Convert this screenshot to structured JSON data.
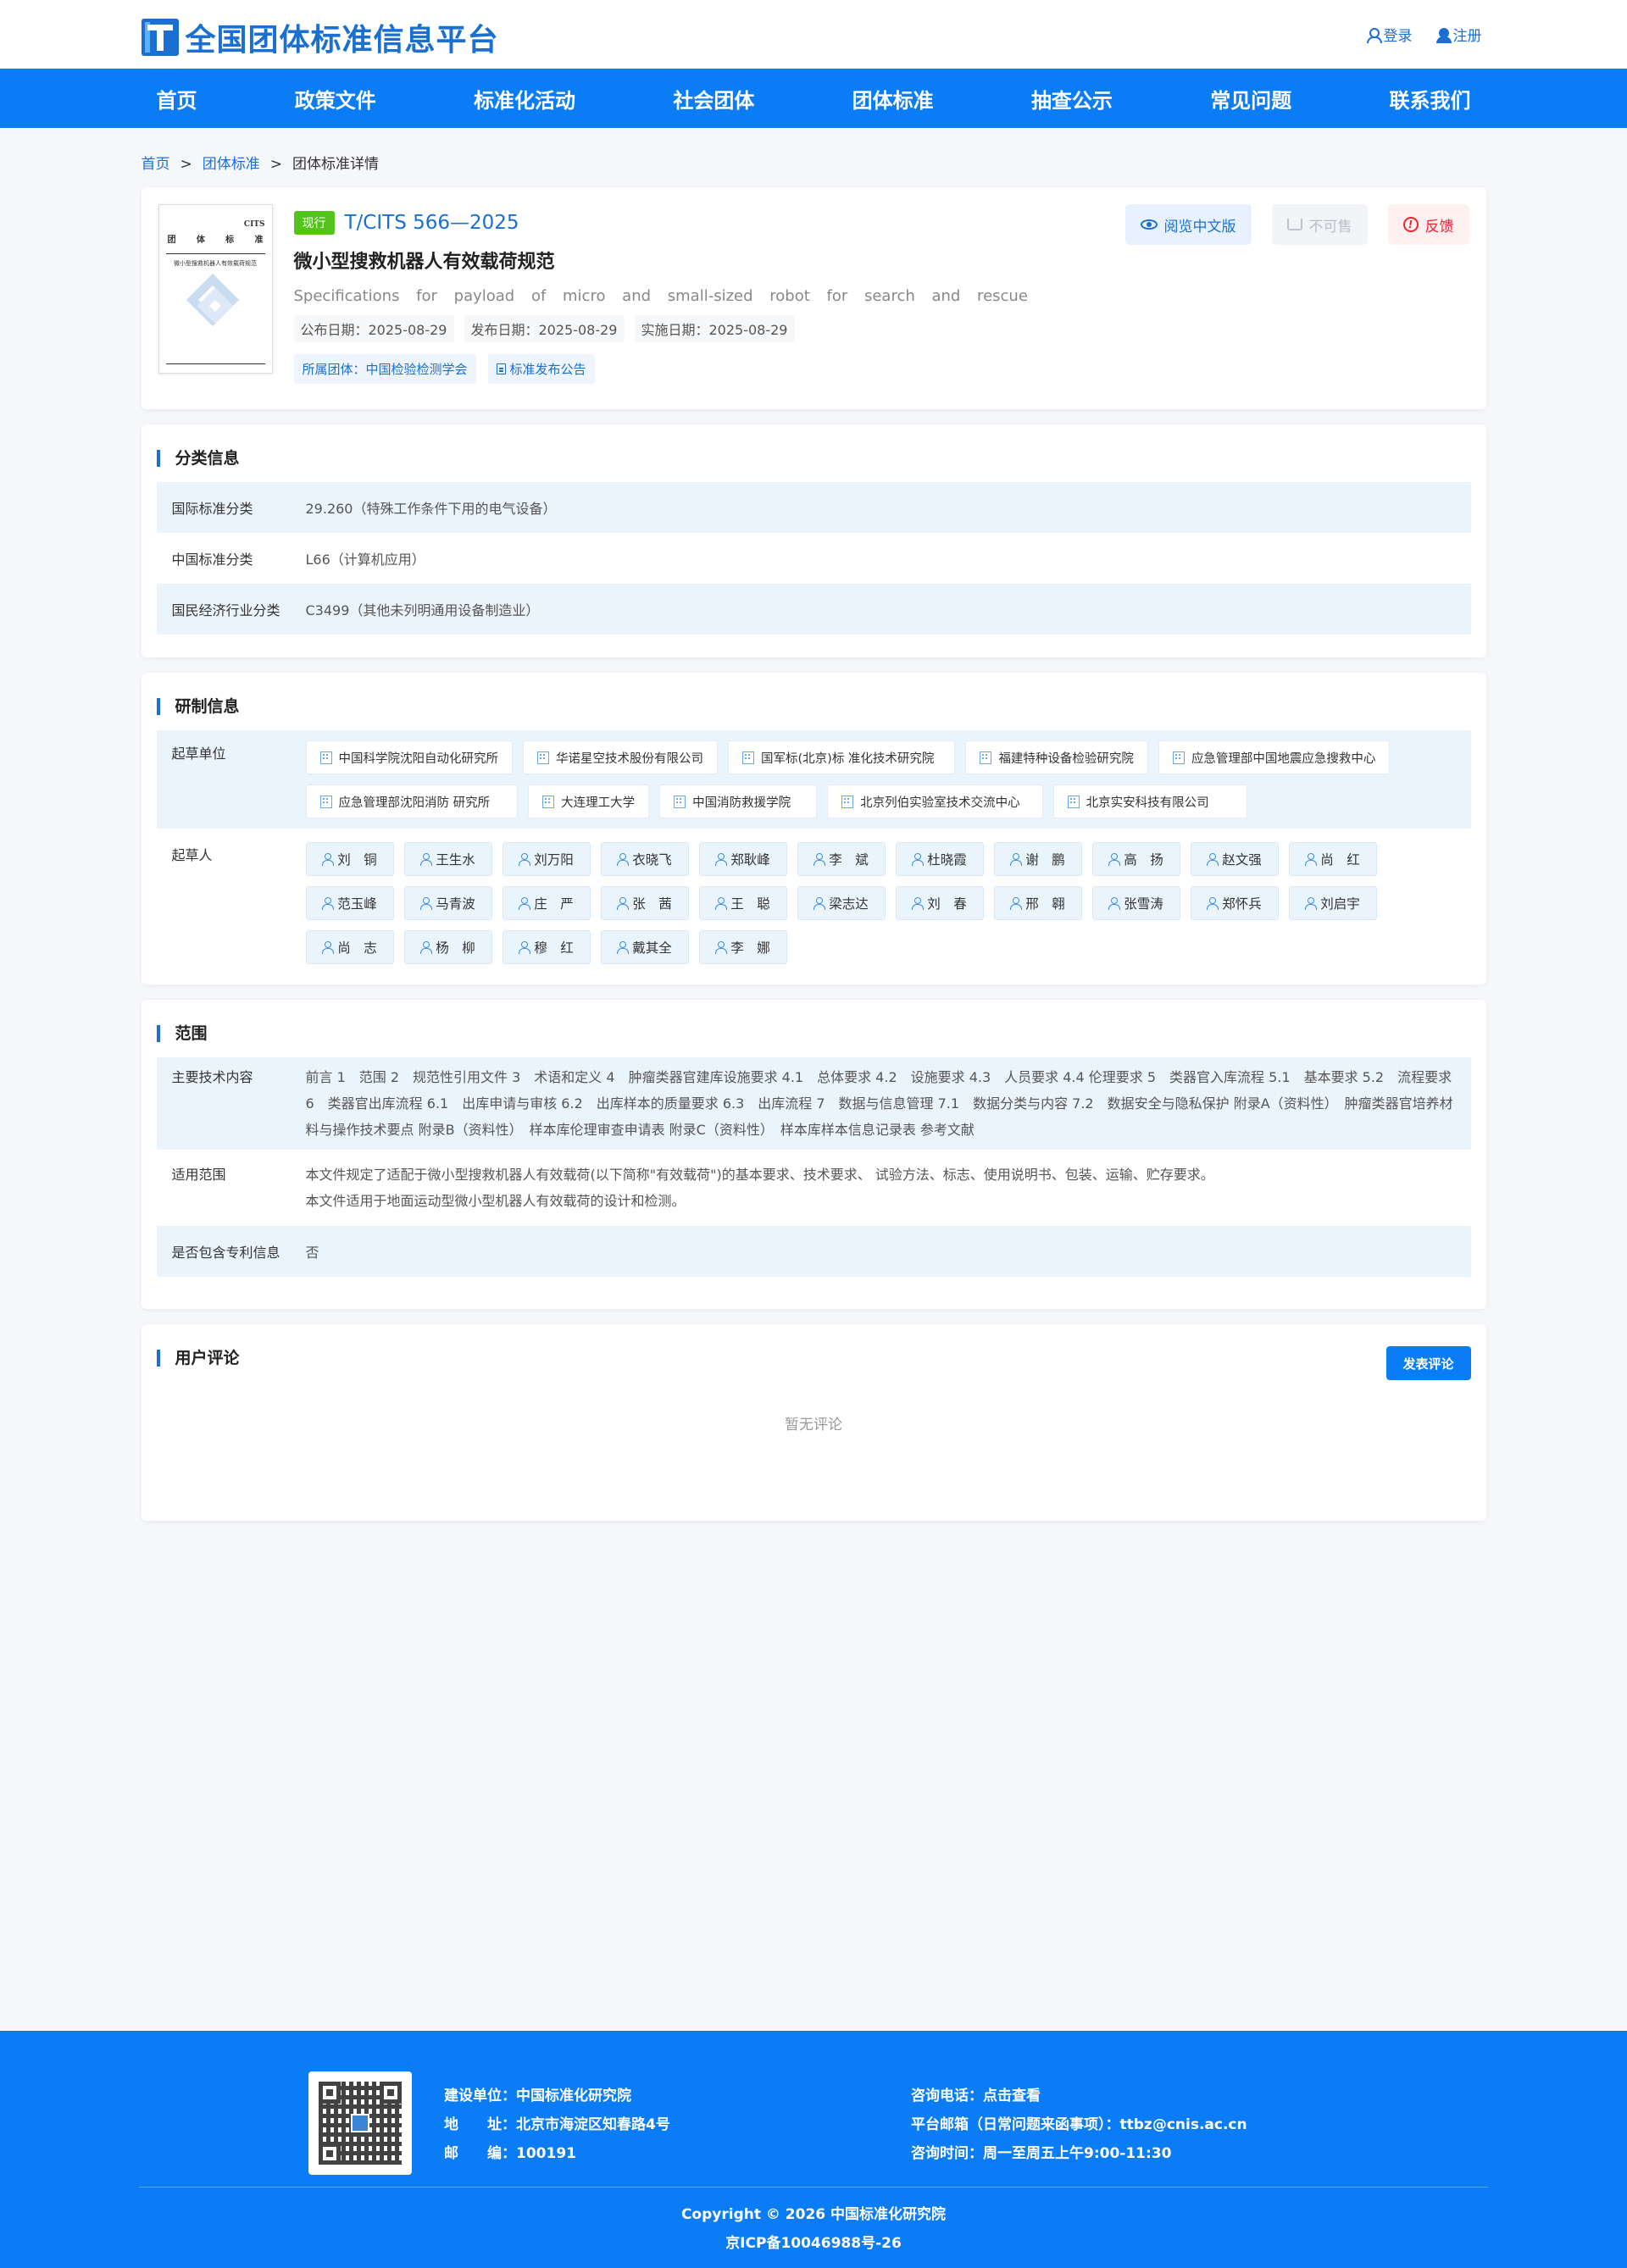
{
  "site": {
    "logo_text": "全国团体标准信息平台",
    "login": "登录",
    "register": "注册"
  },
  "nav": [
    "首页",
    "政策文件",
    "标准化活动",
    "社会团体",
    "团体标准",
    "抽查公示",
    "常见问题",
    "联系我们"
  ],
  "breadcrumb": {
    "home": "首页",
    "sep": ">",
    "level1": "团体标准",
    "current": "团体标准详情"
  },
  "standard": {
    "status": "现行",
    "code": "T/CITS 566—2025",
    "title": "微小型搜救机器人有效载荷规范",
    "title_en": "Specifications for payload of micro and small-sized robot for search and rescue",
    "dates": [
      "公布日期：2025-08-29",
      "发布日期：2025-08-29",
      "实施日期：2025-08-29"
    ],
    "org_tag": "所属团体：中国检验检测学会",
    "announce_tag": "标准发布公告",
    "actions": {
      "read": "阅览中文版",
      "nosale": "不可售",
      "feedback": "反馈"
    },
    "cover": {
      "top": "CITS",
      "name1": "团",
      "name2": "体",
      "name3": "标",
      "name4": "准",
      "title": "微小型搜救机器人有效载荷规范"
    }
  },
  "classification": {
    "title": "分类信息",
    "rows": [
      {
        "k": "国际标准分类",
        "v": "29.260（特殊工作条件下用的电气设备）"
      },
      {
        "k": "中国标准分类",
        "v": "L66（计算机应用）"
      },
      {
        "k": "国民经济行业分类",
        "v": "C3499（其他未列明通用设备制造业）"
      }
    ]
  },
  "development": {
    "title": "研制信息",
    "orgs_label": "起草单位",
    "orgs": [
      "中国科学院沈阳自动化研究所",
      "华诺星空技术股份有限公司",
      "国军标(北京)标 准化技术研究院",
      "福建特种设备检验研究院",
      "应急管理部中国地震应急搜救中心",
      "应急管理部沈阳消防 研究所",
      "大连理工大学",
      "中国消防救援学院",
      "北京列伯实验室技术交流中心",
      "北京实安科技有限公司"
    ],
    "persons_label": "起草人",
    "persons": [
      "刘　铜",
      "王生水",
      "刘万阳",
      "衣晓飞",
      "郑耿峰",
      "李　斌",
      "杜晓霞",
      "谢　鹏",
      "高　扬",
      "赵文强",
      "尚　红",
      "范玉峰",
      "马青波",
      "庄　严",
      "张　茜",
      "王　聪",
      "梁志达",
      "刘　春",
      "邢　翱",
      "张雪涛",
      "郑怀兵",
      "刘启宇",
      "尚　志",
      "杨　柳",
      "穆　红",
      "戴其全",
      "李　娜"
    ]
  },
  "scope": {
    "title": "范围",
    "tech_label": "主要技术内容",
    "tech_content": "前言 1　范围 2　规范性引用文件 3　术语和定义 4　肿瘤类器官建库设施要求 4.1　总体要求 4.2　设施要求 4.3　人员要求 4.4 伦理要求 5　类器官入库流程 5.1　基本要求 5.2　流程要求 6　类器官出库流程 6.1　出库申请与审核 6.2　出库样本的质量要求 6.3　出库流程 7　数据与信息管理 7.1　数据分类与内容 7.2　数据安全与隐私保护 附录A（资料性）　肿瘤类器官培养材料与操作技术要点 附录B（资料性）　样本库伦理审查申请表 附录C（资料性）　样本库样本信息记录表 参考文献",
    "range_label": "适用范围",
    "range_line1": "本文件规定了适配于微小型搜救机器人有效载荷(以下简称\"有效载荷\")的基本要求、技术要求、 试验方法、标志、使用说明书、包装、运输、贮存要求。",
    "range_line2": "本文件适用于地面运动型微小型机器人有效载荷的设计和检测。",
    "patent_label": "是否包含专利信息",
    "patent_value": "否"
  },
  "comments": {
    "title": "用户评论",
    "button": "发表评论",
    "empty": "暂无评论"
  },
  "footer": {
    "builder": "建设单位：中国标准化研究院",
    "address": "地　　址：北京市海淀区知春路4号",
    "postcode": "邮　　编：100191",
    "phone": "咨询电话：点击查看",
    "email": "平台邮箱（日常问题来函事项）：ttbz@cnis.ac.cn",
    "hours": "咨询时间：周一至周五上午9:00-11:30",
    "copyright": "Copyright © 2026 中国标准化研究院",
    "icp": "京ICP备10046988号-26"
  },
  "colors": {
    "primary": "#0a7cf6",
    "brand": "#1a6fd0",
    "status_green": "#52c41a",
    "danger": "#f5222d"
  }
}
